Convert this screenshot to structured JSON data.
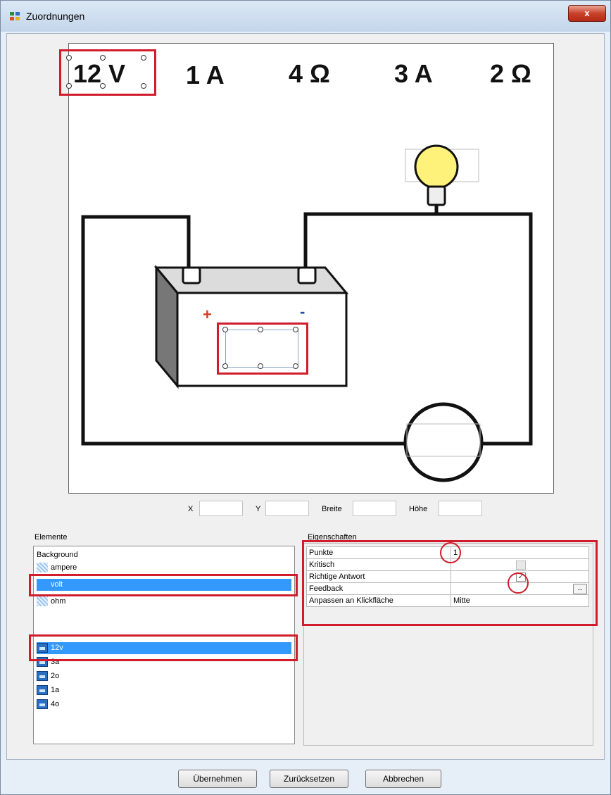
{
  "window": {
    "title": "Zuordnungen",
    "close_glyph": "x"
  },
  "canvas": {
    "labels": [
      "12 V",
      "1 A",
      "4 Ω",
      "3 A",
      "2 Ω"
    ],
    "plus": "+",
    "minus": "-"
  },
  "coords": {
    "x_label": "X",
    "y_label": "Y",
    "width_label": "Breite",
    "height_label": "Höhe",
    "x": "",
    "y": "",
    "width": "",
    "height": ""
  },
  "elements": {
    "label": "Elemente",
    "areas": [
      "Background",
      "ampere",
      "volt",
      "ohm"
    ],
    "images": [
      "12v",
      "3a",
      "2o",
      "1a",
      "4o"
    ]
  },
  "properties": {
    "label": "Eigenschaften",
    "rows": [
      {
        "name": "Punkte",
        "value": "1"
      },
      {
        "name": "Kritisch",
        "value": ""
      },
      {
        "name": "Richtige Antwort",
        "value": ""
      },
      {
        "name": "Feedback",
        "value": ""
      },
      {
        "name": "Anpassen an Klickfläche",
        "value": "Mitte"
      }
    ],
    "ellipsis": "..."
  },
  "buttons": {
    "apply": "Übernehmen",
    "reset": "Zurücksetzen",
    "cancel": "Abbrechen"
  },
  "colors": {
    "highlight": "#d01c2b",
    "selection": "#3399ff",
    "bulb": "#fff27a"
  }
}
